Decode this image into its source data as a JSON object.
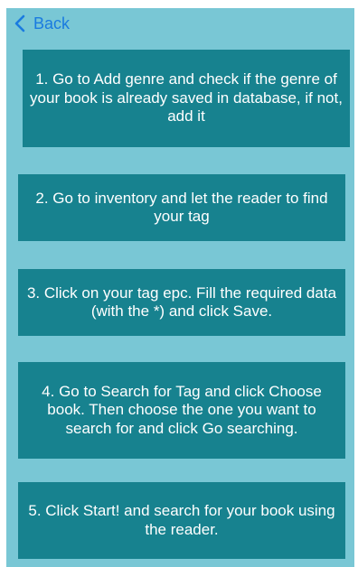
{
  "nav": {
    "back_label": "Back",
    "back_icon": "chevron-left-icon"
  },
  "steps": [
    {
      "text": "1. Go to Add genre and check if the genre of your book is already saved in database, if not, add it"
    },
    {
      "text": "2. Go to inventory and let the reader to find your tag"
    },
    {
      "text": "3. Click on your tag epc. Fill the required data (with the *) and click Save."
    },
    {
      "text": "4. Go to Search for Tag and click Choose book. Then choose the one you want to search for and click Go searching."
    },
    {
      "text": "5. Click Start! and search for your book using the reader."
    }
  ],
  "colors": {
    "background": "#79c7d5",
    "step_box": "#17828f",
    "text": "#ffffff",
    "accent": "#1a7be0"
  }
}
